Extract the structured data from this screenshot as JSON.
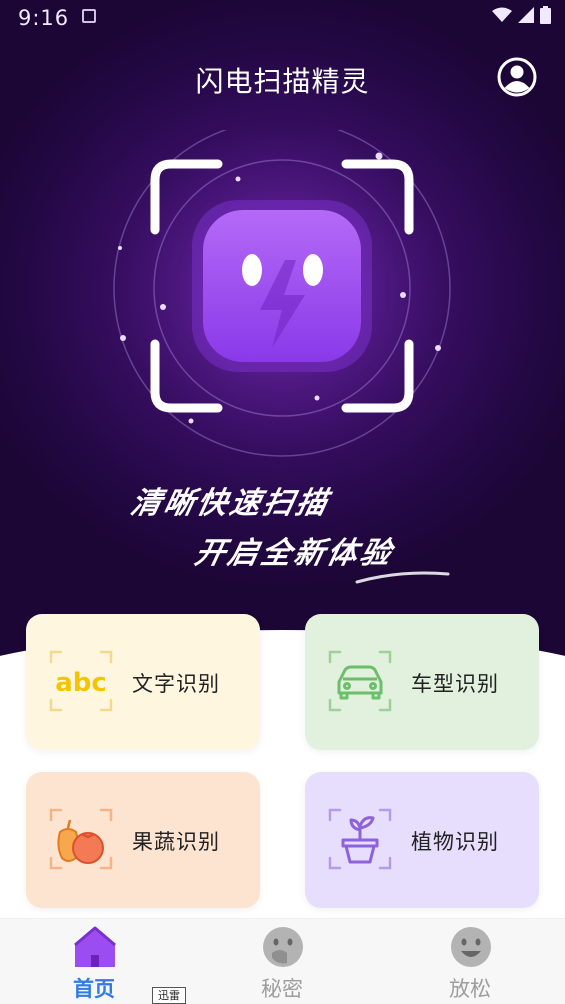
{
  "status_bar": {
    "time": "9:16",
    "icons": [
      "notification-icon",
      "wifi-icon",
      "signal-icon",
      "battery-icon"
    ]
  },
  "header": {
    "title": "闪电扫描精灵",
    "user_icon": "user-avatar-icon"
  },
  "hero": {
    "slogan_line1": "清晰快速扫描",
    "slogan_line2": "开启全新体验",
    "mascot_icon": "lightning-mascot-icon"
  },
  "features": [
    {
      "label": "文字识别",
      "icon": "abc-text-icon",
      "bg": "#fff6e0"
    },
    {
      "label": "车型识别",
      "icon": "car-icon",
      "bg": "#e2f0de"
    },
    {
      "label": "果蔬识别",
      "icon": "fruit-vegetable-icon",
      "bg": "#fde4d0"
    },
    {
      "label": "植物识别",
      "icon": "plant-pot-icon",
      "bg": "#e7defe"
    }
  ],
  "icon_glyphs": {
    "text": "abc"
  },
  "tabs": [
    {
      "label": "首页",
      "icon": "home-icon",
      "active": true
    },
    {
      "label": "秘密",
      "icon": "secret-face-icon",
      "active": false
    },
    {
      "label": "放松",
      "icon": "smile-face-icon",
      "active": false
    }
  ],
  "toast": "迅雷",
  "colors": {
    "hero_bg": "#2a0a4d",
    "accent_purple": "#9b4df2",
    "tab_active": "#2f7be8",
    "tab_inactive": "#9e9e9e"
  }
}
